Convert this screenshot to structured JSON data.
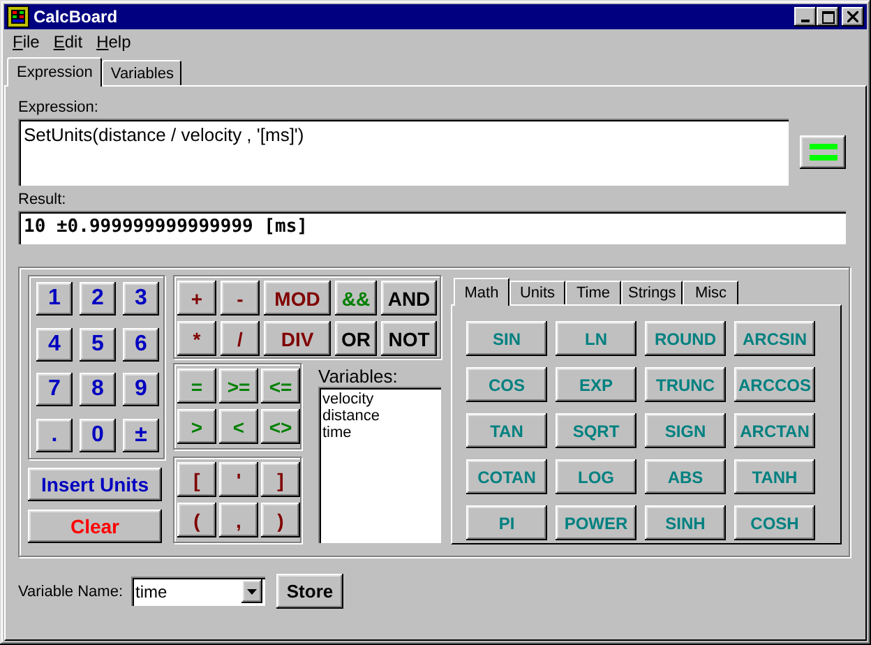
{
  "window": {
    "title": "CalcBoard"
  },
  "menu": [
    "File",
    "Edit",
    "Help"
  ],
  "tabs": [
    {
      "label": "Expression",
      "selected": true
    },
    {
      "label": "Variables",
      "selected": false
    }
  ],
  "expression": {
    "label": "Expression:",
    "value": "SetUnits(distance / velocity , '[ms]')"
  },
  "result": {
    "label": "Result:",
    "value": "10 ±0.999999999999999 [ms]"
  },
  "digit_keys": [
    {
      "label": "1",
      "color": "#0000c0"
    },
    {
      "label": "2",
      "color": "#0000c0"
    },
    {
      "label": "3",
      "color": "#0000c0"
    },
    {
      "label": "4",
      "color": "#0000c0"
    },
    {
      "label": "5",
      "color": "#0000c0"
    },
    {
      "label": "6",
      "color": "#0000c0"
    },
    {
      "label": "7",
      "color": "#0000c0"
    },
    {
      "label": "8",
      "color": "#0000c0"
    },
    {
      "label": "9",
      "color": "#0000c0"
    },
    {
      "label": ".",
      "color": "#0000c0"
    },
    {
      "label": "0",
      "color": "#0000c0"
    },
    {
      "label": "±",
      "color": "#0000c0"
    }
  ],
  "insert_units": {
    "label": "Insert Units",
    "color": "#0000c0"
  },
  "clear": {
    "label": "Clear",
    "color": "#ff0000"
  },
  "operator_keys": [
    {
      "label": "+",
      "color": "#800000",
      "kind": "small"
    },
    {
      "label": "-",
      "color": "#800000",
      "kind": "small"
    },
    {
      "label": "MOD",
      "color": "#800000",
      "kind": "wide"
    },
    {
      "label": "&&",
      "color": "#008000",
      "kind": "mid"
    },
    {
      "label": "AND",
      "color": "#000000",
      "kind": "large"
    },
    {
      "label": "*",
      "color": "#800000",
      "kind": "small"
    },
    {
      "label": "/",
      "color": "#800000",
      "kind": "small"
    },
    {
      "label": "DIV",
      "color": "#800000",
      "kind": "wide"
    },
    {
      "label": "OR",
      "color": "#000000",
      "kind": "mid"
    },
    {
      "label": "NOT",
      "color": "#000000",
      "kind": "large"
    }
  ],
  "compare_keys": [
    {
      "label": "=",
      "color": "#008000"
    },
    {
      "label": ">=",
      "color": "#008000"
    },
    {
      "label": "<=",
      "color": "#008000"
    },
    {
      "label": ">",
      "color": "#008000"
    },
    {
      "label": "<",
      "color": "#008000"
    },
    {
      "label": "<>",
      "color": "#008000"
    }
  ],
  "bracket_keys": [
    {
      "label": "[",
      "color": "#800000"
    },
    {
      "label": "'",
      "color": "#800000"
    },
    {
      "label": "]",
      "color": "#800000"
    },
    {
      "label": "(",
      "color": "#800000"
    },
    {
      "label": ",",
      "color": "#800000"
    },
    {
      "label": ")",
      "color": "#800000"
    }
  ],
  "variables": {
    "label": "Variables:",
    "items": [
      "velocity",
      "distance",
      "time"
    ]
  },
  "function_tabs": [
    {
      "label": "Math",
      "selected": true
    },
    {
      "label": "Units",
      "selected": false
    },
    {
      "label": "Time",
      "selected": false
    },
    {
      "label": "Strings",
      "selected": false
    },
    {
      "label": "Misc",
      "selected": false
    }
  ],
  "function_keys": [
    "SIN",
    "LN",
    "ROUND",
    "ARCSIN",
    "COS",
    "EXP",
    "TRUNC",
    "ARCCOS",
    "TAN",
    "SQRT",
    "SIGN",
    "ARCTAN",
    "COTAN",
    "LOG",
    "ABS",
    "TANH",
    "PI",
    "POWER",
    "SINH",
    "COSH"
  ],
  "variable_name": {
    "label": "Variable Name:",
    "value": "time"
  },
  "store": "Store"
}
